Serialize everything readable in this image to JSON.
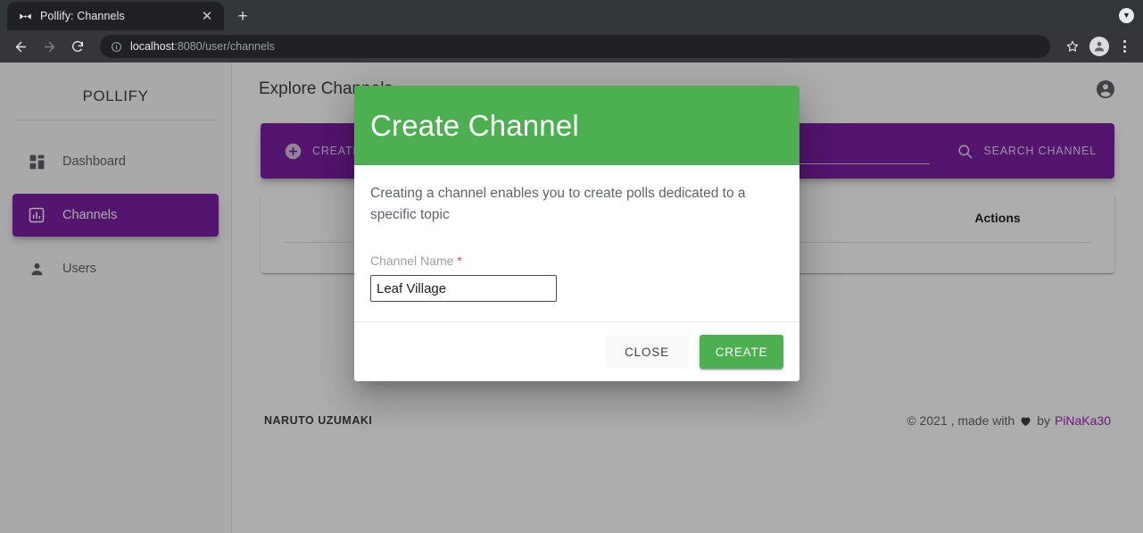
{
  "browser": {
    "tab": {
      "title": "Pollify: Channels",
      "favicon_icon": "bowtie-icon",
      "close_icon": "close-icon"
    },
    "new_tab_label": "+",
    "window_control_icon": "chevron-down-circle-icon",
    "nav": {
      "back_icon": "arrow-left-icon",
      "forward_icon": "arrow-right-icon",
      "reload_icon": "reload-icon"
    },
    "omnibox": {
      "info_icon": "info-circle-icon",
      "url_host": "localhost",
      "url_path": ":8080/user/channels"
    },
    "bookmark_icon": "star-icon",
    "profile_icon": "account-circle-icon",
    "menu_icon": "kebab-menu-icon"
  },
  "sidebar": {
    "brand": "POLLIFY",
    "items": [
      {
        "label": "Dashboard",
        "icon": "dashboard-grid-icon",
        "active": false
      },
      {
        "label": "Channels",
        "icon": "bar-chart-box-icon",
        "active": true
      },
      {
        "label": "Users",
        "icon": "person-icon",
        "active": false
      }
    ]
  },
  "main": {
    "page_title": "Explore Channels",
    "account_icon": "account-circle-icon",
    "toolbar": {
      "create_label": "CREATE CHANNEL",
      "create_icon": "plus-circle-icon",
      "search_placeholder": "",
      "search_value": "",
      "search_label": "SEARCH CHANNEL",
      "search_icon": "search-icon"
    },
    "table": {
      "headers": [
        "Actions"
      ]
    },
    "footer": {
      "left": "NARUTO UZUMAKI",
      "copyright": "© 2021 , made with",
      "heart_icon": "heart-icon",
      "by": "by",
      "author": "PiNaKa30"
    }
  },
  "dialog": {
    "title": "Create Channel",
    "description": "Creating a channel enables you to create polls dedicated to a specific topic",
    "field_label": "Channel Name",
    "required_marker": "*",
    "field_value": "Leaf Village",
    "field_placeholder": "",
    "close_label": "CLOSE",
    "create_label": "CREATE"
  },
  "colors": {
    "dialog_header_green": "#4caf50",
    "brand_purple": "#7b1fa2",
    "accent_link_purple": "#9c27b0",
    "required_red": "#f44336"
  }
}
